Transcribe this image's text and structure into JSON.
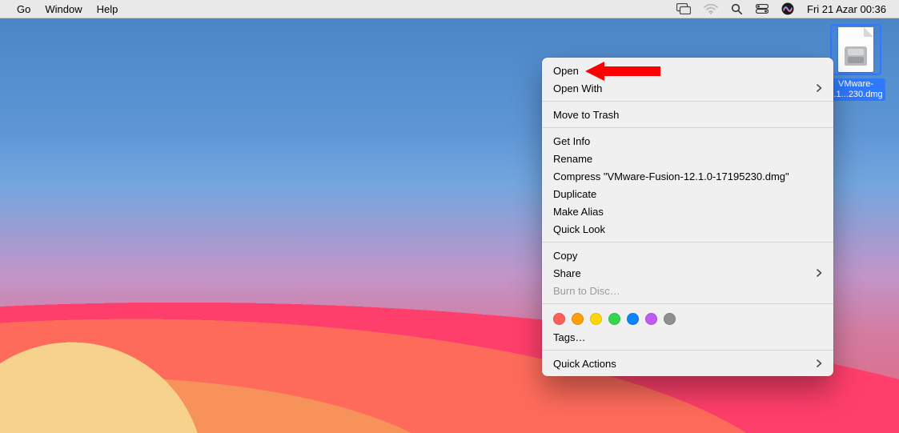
{
  "menubar": {
    "left": [
      "Go",
      "Window",
      "Help"
    ],
    "clock": "Fri 21 Azar  00:36"
  },
  "desktop": {
    "file_label_line1": "VMware-",
    "file_label_line2": "...1...230.dmg"
  },
  "context_menu": {
    "open": "Open",
    "open_with": "Open With",
    "move_to_trash": "Move to Trash",
    "get_info": "Get Info",
    "rename": "Rename",
    "compress": "Compress \"VMware-Fusion-12.1.0-17195230.dmg\"",
    "duplicate": "Duplicate",
    "make_alias": "Make Alias",
    "quick_look": "Quick Look",
    "copy": "Copy",
    "share": "Share",
    "burn": "Burn to Disc…",
    "tags": "Tags…",
    "quick_actions": "Quick Actions",
    "tag_colors": [
      "#ff5f57",
      "#ff9f0a",
      "#ffd60a",
      "#32d74b",
      "#0a84ff",
      "#bf5af2",
      "#8e8e93"
    ]
  }
}
